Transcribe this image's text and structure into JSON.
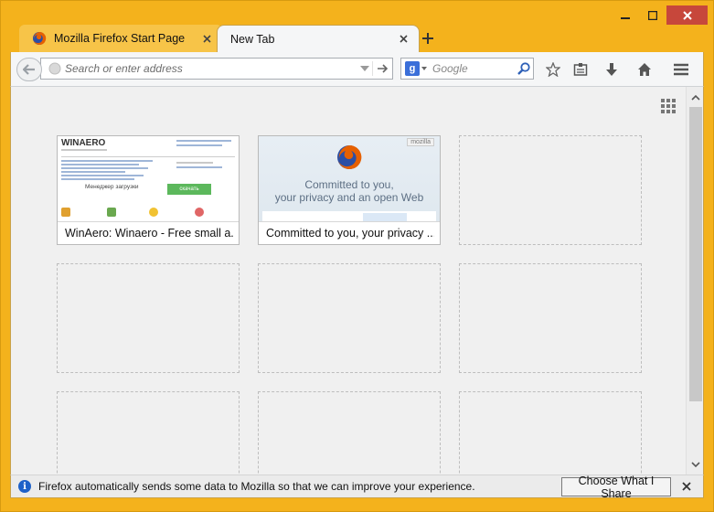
{
  "window": {
    "controls": [
      "minimize-icon",
      "maximize-icon",
      "close-icon"
    ],
    "frame_color": "#f4b21c",
    "close_color": "#c7473b"
  },
  "tabs": [
    {
      "label": "Mozilla Firefox Start Page",
      "icon": "firefox-icon",
      "active": false
    },
    {
      "label": "New Tab",
      "active": true
    }
  ],
  "navbar": {
    "url_placeholder": "Search or enter address",
    "search_placeholder": "Google",
    "search_engine": "google-icon",
    "search_engine_letter": "g",
    "tools": [
      "bookmark-star-icon",
      "reading-list-icon",
      "download-icon",
      "home-icon",
      "menu-icon"
    ]
  },
  "newtab": {
    "tiles": [
      {
        "title": "WinAero: Winaero - Free small a...",
        "thumbnail": "winaero"
      },
      {
        "title": "Committed to you, your privacy ...",
        "thumbnail": "mozilla"
      }
    ],
    "winaero_thumb": {
      "brand": "WINAERO",
      "button": "скачать",
      "manager": "Менеджер загрузки"
    },
    "mozilla_thumb": {
      "badge": "mozilla",
      "line1": "Committed to you,",
      "line2": "your privacy and an open Web"
    }
  },
  "notification": {
    "message": "Firefox automatically sends some data to Mozilla so that we can improve your experience.",
    "button": "Choose What I Share",
    "info_glyph": "i"
  }
}
